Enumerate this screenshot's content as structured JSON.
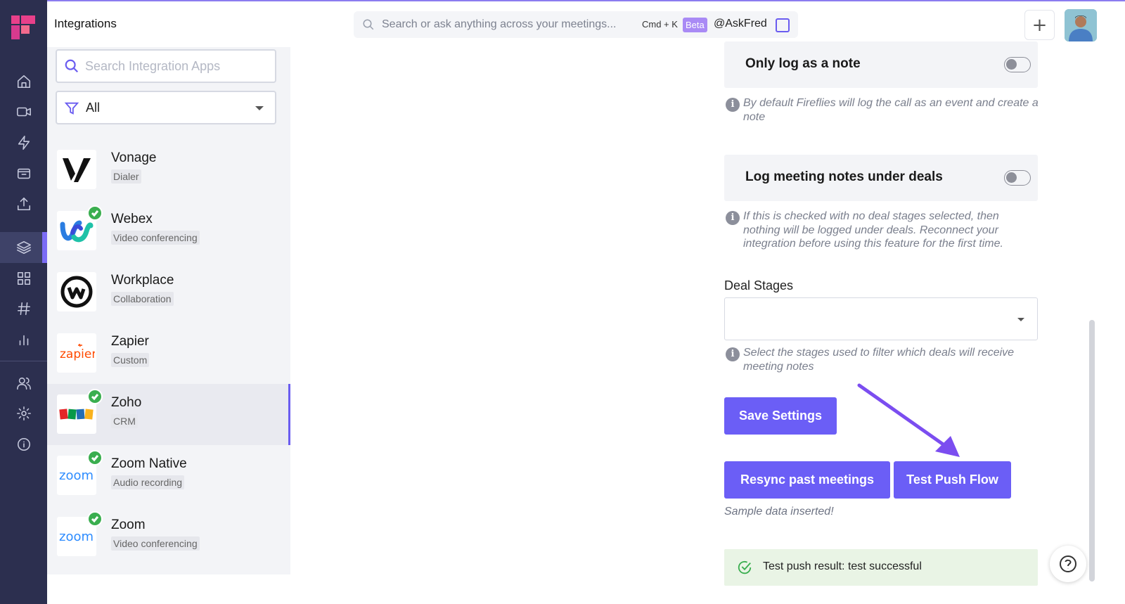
{
  "header": {
    "title": "Integrations",
    "search_placeholder": "Search or ask anything across your meetings...",
    "shortcut": "Cmd + K",
    "beta_badge": "Beta",
    "askfred": "@AskFred"
  },
  "sidebar": {
    "items": [
      "home-icon",
      "video-icon",
      "lightning-icon",
      "calendar-icon",
      "upload-icon",
      "layers-icon",
      "apps-grid-icon",
      "hashtag-icon",
      "analytics-icon",
      "team-icon",
      "settings-icon",
      "info-icon"
    ],
    "active": "layers-icon"
  },
  "integrations": {
    "search_placeholder": "Search Integration Apps",
    "filter_value": "All",
    "apps": [
      {
        "name": "Vonage",
        "category": "Dialer",
        "connected": false
      },
      {
        "name": "Webex",
        "category": "Video conferencing",
        "connected": true
      },
      {
        "name": "Workplace",
        "category": "Collaboration",
        "connected": false
      },
      {
        "name": "Zapier",
        "category": "Custom",
        "connected": false
      },
      {
        "name": "Zoho",
        "category": "CRM",
        "connected": true,
        "active": true
      },
      {
        "name": "Zoom Native",
        "category": "Audio recording",
        "connected": true
      },
      {
        "name": "Zoom",
        "category": "Video conferencing",
        "connected": true
      }
    ]
  },
  "settings": {
    "only_log_note": {
      "label": "Only log as a note",
      "enabled": false,
      "info": "By default Fireflies will log the call as an event and create a note"
    },
    "log_under_deals": {
      "label": "Log meeting notes under deals",
      "enabled": false,
      "info": "If this is checked with no deal stages selected, then nothing will be logged under deals. Reconnect your integration before using this feature for the first time."
    },
    "deal_stages": {
      "label": "Deal Stages",
      "value": "",
      "info": "Select the stages used to filter which deals will receive meeting notes"
    },
    "save_button": "Save Settings",
    "resync_button": "Resync past meetings",
    "test_button": "Test Push Flow",
    "sample_text": "Sample data inserted!",
    "result_text": "Test push result: test successful"
  },
  "colors": {
    "accent": "#6b5ef6",
    "sidebar_bg": "#2c2f4f",
    "success": "#3aae4f"
  }
}
